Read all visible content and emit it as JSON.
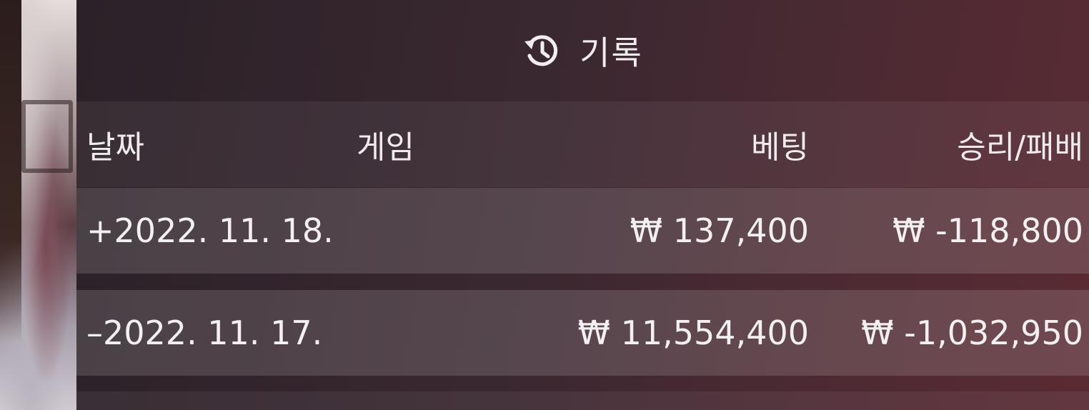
{
  "header": {
    "title": "기록",
    "icon": "history-icon"
  },
  "table": {
    "columns": {
      "date": "날짜",
      "game": "게임",
      "bet": "베팅",
      "result": "승리/패배"
    },
    "rows": [
      {
        "date": "+2022. 11. 18.",
        "game": "",
        "bet": "₩ 137,400",
        "result": "₩ -118,800"
      },
      {
        "date": "–2022. 11. 17.",
        "game": "",
        "bet": "₩ 11,554,400",
        "result": "₩ -1,032,950"
      }
    ]
  },
  "colors": {
    "panel_left": "#2b2128",
    "panel_right": "#5a2b33",
    "text": "#f3f0f2"
  }
}
